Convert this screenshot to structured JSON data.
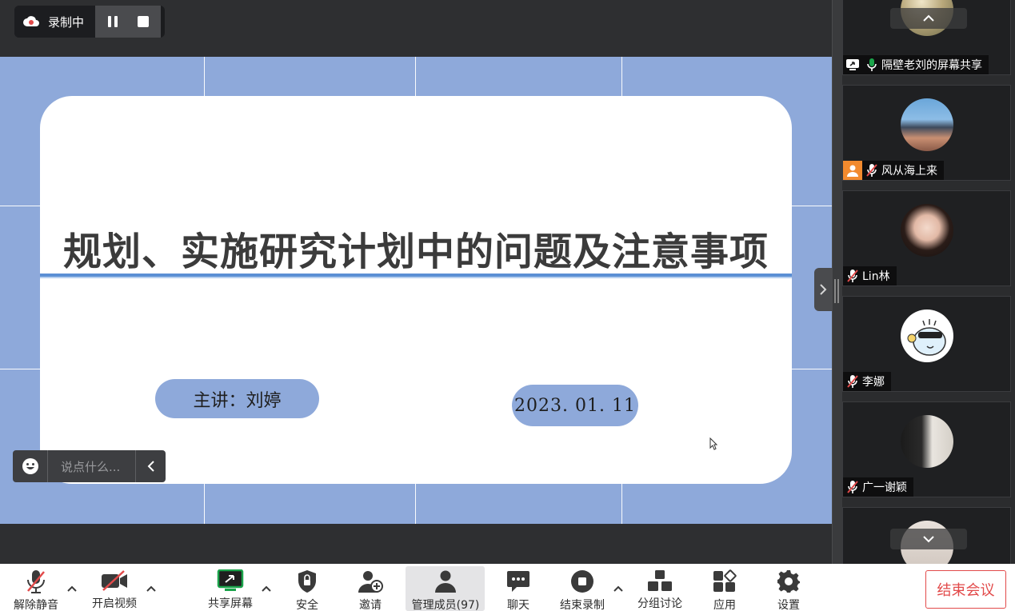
{
  "recording": {
    "status_label": "录制中"
  },
  "slide": {
    "title": "规划、实施研究计划中的问题及注意事项",
    "presenter": "主讲：刘婷",
    "date": "2023. 01. 11"
  },
  "chat": {
    "placeholder": "说点什么..."
  },
  "participants": [
    {
      "name": "隔壁老刘的屏幕共享",
      "status": "screen-share"
    },
    {
      "name": "风从海上来",
      "status": "muted"
    },
    {
      "name": "Lin林",
      "status": "muted"
    },
    {
      "name": "李娜",
      "status": "muted"
    },
    {
      "name": "广一谢颖",
      "status": "muted"
    }
  ],
  "toolbar": {
    "unmute": "解除静音",
    "start_video": "开启视频",
    "share_screen": "共享屏幕",
    "security": "安全",
    "invite": "邀请",
    "manage_members": "管理成员(97)",
    "chat": "聊天",
    "end_recording": "结束录制",
    "breakout": "分组讨论",
    "apps": "应用",
    "settings": "设置",
    "end_meeting": "结束会议"
  },
  "colors": {
    "slide_background": "#8ea9da",
    "accent_green": "#1aa34a",
    "end_meeting_red": "#e24a4a"
  }
}
